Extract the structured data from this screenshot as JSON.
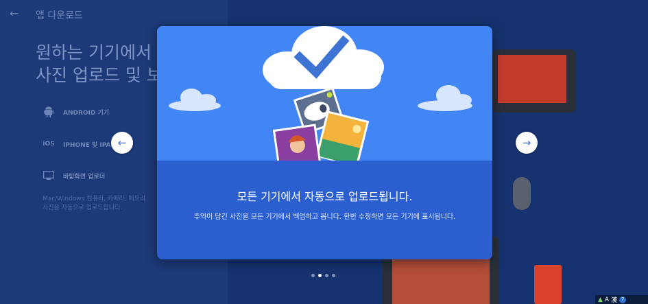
{
  "header": {
    "back_icon": "arrow-left-icon",
    "title": "앱 다운로드"
  },
  "hero": {
    "text": "원하는 기기에서\n사진 업로드 및 보"
  },
  "options": [
    {
      "label": "ANDROID 기기",
      "icon": "android-icon"
    },
    {
      "label": "IPHONE 및 IPAD",
      "icon": "ios-icon",
      "icon_text": "iOS"
    },
    {
      "label": "바탕화면 업로더",
      "icon": "monitor-icon"
    }
  ],
  "options_desc": "Mac/Windows 컴퓨터, 카메라, 메모리\n사진을 자동으로 업로드합니다.",
  "carousel": {
    "prev_icon": "arrow-left-icon",
    "next_icon": "arrow-right-icon",
    "title": "모든 기기에서 자동으로 업로드됩니다.",
    "description": "추억이 담긴 사진을 모든 기기에서 백업하고 봅니다. 한번 수정하면 모든 기기에 표시됩니다.",
    "dots": 4,
    "active_dot": 1
  },
  "tray": {
    "ime": "A",
    "ime2": "漢"
  },
  "colors": {
    "modal_top": "#4285f4",
    "modal_bottom": "#2b5fcf",
    "checkmark": "#3d74d4",
    "left_panel": "#1c3a78",
    "background": "#14306b"
  }
}
